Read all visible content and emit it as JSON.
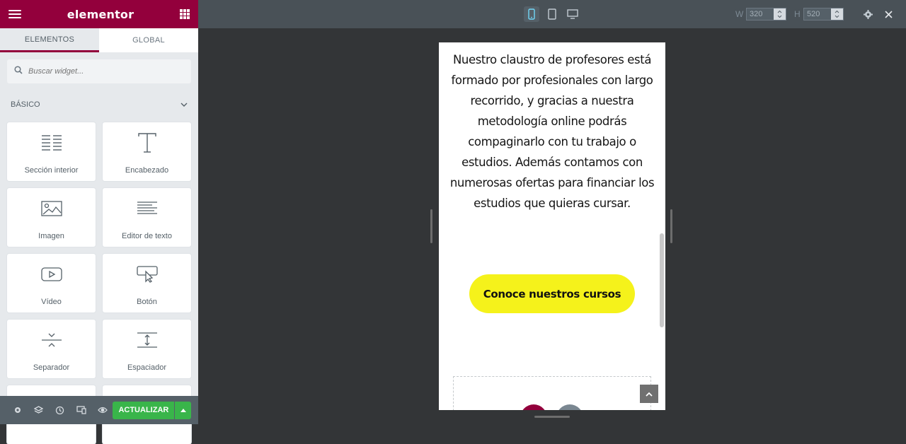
{
  "app": {
    "brand": "elementor"
  },
  "sidebar": {
    "tabs": [
      "ELEMENTOS",
      "GLOBAL"
    ],
    "search": {
      "placeholder": "Buscar widget..."
    },
    "category": "BÁSICO",
    "widgets": [
      {
        "label": "Sección interior",
        "icon": "inner-section-icon"
      },
      {
        "label": "Encabezado",
        "icon": "heading-icon"
      },
      {
        "label": "Imagen",
        "icon": "image-icon"
      },
      {
        "label": "Editor de texto",
        "icon": "text-editor-icon"
      },
      {
        "label": "Vídeo",
        "icon": "video-icon"
      },
      {
        "label": "Botón",
        "icon": "button-icon"
      },
      {
        "label": "Separador",
        "icon": "divider-icon"
      },
      {
        "label": "Espaciador",
        "icon": "spacer-icon"
      }
    ],
    "footer": {
      "publish_label": "ACTUALIZAR"
    }
  },
  "topbar": {
    "devices": [
      "mobile",
      "tablet",
      "desktop"
    ],
    "active_device": "mobile",
    "width_label": "W",
    "width_value": "320",
    "height_label": "H",
    "height_value": "520"
  },
  "preview": {
    "paragraph": "Nuestro claustro de profesores está formado por profesionales con largo recorrido, y gracias a nuestra metodología online podrás compaginarlo con tu trabajo o estudios. Además contamos con numerosas ofertas para financiar los estudios que quieras cursar.",
    "cta_label": "Conoce nuestros cursos"
  },
  "colors": {
    "brand": "#93003c",
    "publish": "#39b54a",
    "cta": "#f5f21b",
    "topbar": "#495157"
  }
}
